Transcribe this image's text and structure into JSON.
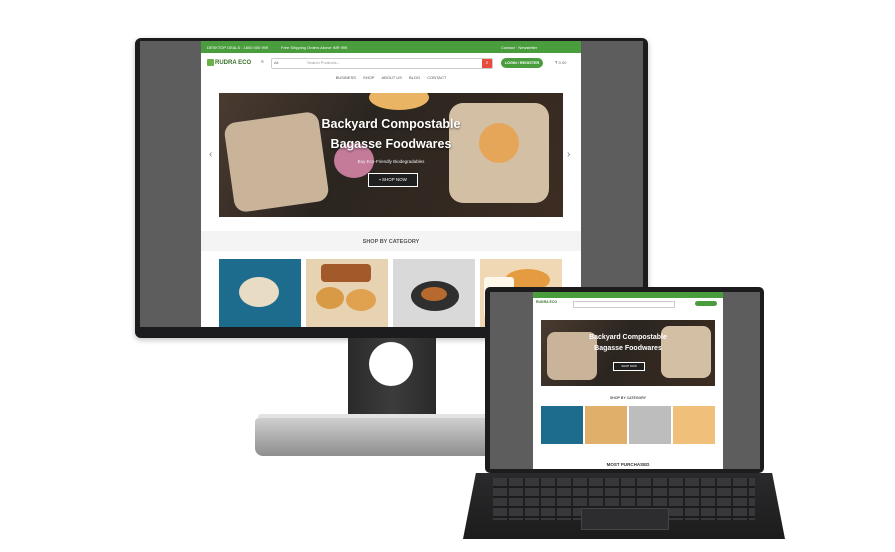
{
  "monitor": {
    "topbar": {
      "left_text": "DESKTOP DEALS : 1800 000 999",
      "mid_text": "Free Shipping Orders Above INR 999",
      "right_text": "Contact   ·   Newsletter"
    },
    "logo_text": "RUDRA ECO",
    "search": {
      "all_label": "All",
      "placeholder": "Search Products..."
    },
    "login_label": "LOGIN / REGISTER",
    "cart_label": "₹ 0.00",
    "nav": [
      "BUSINESS",
      "SHOP",
      "ABOUT US",
      "BLOG",
      "CONTACT"
    ],
    "hero": {
      "title_line1": "Backyard Compostable",
      "title_line2": "Bagasse Foodwares",
      "subtitle": "Buy Eco-Friendly Biodegradables",
      "button": "SHOP NOW"
    },
    "section_title": "SHOP BY CATEGORY"
  },
  "laptop": {
    "logo_text": "RUDRA ECO",
    "hero": {
      "title_line1": "Backyard Compostable",
      "title_line2": "Bagasse Foodwares",
      "button": "SHOP NOW"
    },
    "section_title": "SHOP BY CATEGORY",
    "section2_title": "MOST PURCHASED"
  },
  "colors": {
    "brand_green": "#4a9d3d",
    "search_button": "#e84c3d"
  }
}
